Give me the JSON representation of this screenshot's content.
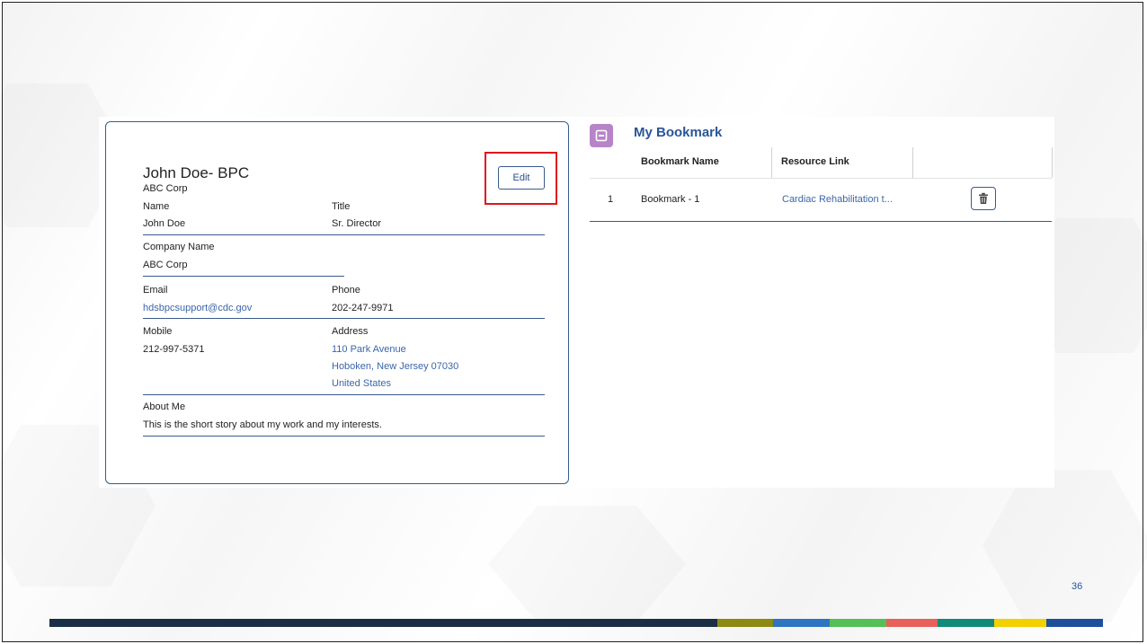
{
  "profile": {
    "title": "John Doe- BPC",
    "subtitle": "ABC Corp",
    "edit_label": "Edit",
    "fields": {
      "name_label": "Name",
      "name_value": "John Doe",
      "title_label": "Title",
      "title_value": "Sr. Director",
      "company_label": "Company Name",
      "company_value": "ABC Corp",
      "email_label": "Email",
      "email_value": "hdsbpcsupport@cdc.gov",
      "phone_label": "Phone",
      "phone_value": "202-247-9971",
      "mobile_label": "Mobile",
      "mobile_value": "212-997-5371",
      "address_label": "Address",
      "address_line1": "110 Park Avenue",
      "address_line2": "Hoboken, New Jersey 07030",
      "address_line3": "United States",
      "about_label": "About Me",
      "about_value": "This is the short story about my work and my interests."
    }
  },
  "bookmarks": {
    "title": "My Bookmark",
    "columns": [
      "Bookmark Name",
      "Resource Link"
    ],
    "rows": [
      {
        "index": "1",
        "name": "Bookmark - 1",
        "link": "Cardiac Rehabilitation t..."
      }
    ]
  },
  "slide": {
    "page_number": "36",
    "footer_colors": [
      "#1b2e45",
      "#8a8a14",
      "#2f74c0",
      "#55c055",
      "#e8605a",
      "#118a78",
      "#f2d100",
      "#1e4f9c"
    ]
  },
  "icons": {
    "bookmark_icon": "bookmark-icon",
    "trash_icon": "trash-icon"
  },
  "colors": {
    "accent": "#2a5599",
    "highlight": "#e0141e",
    "bookmark_icon_bg": "#b884c8"
  }
}
